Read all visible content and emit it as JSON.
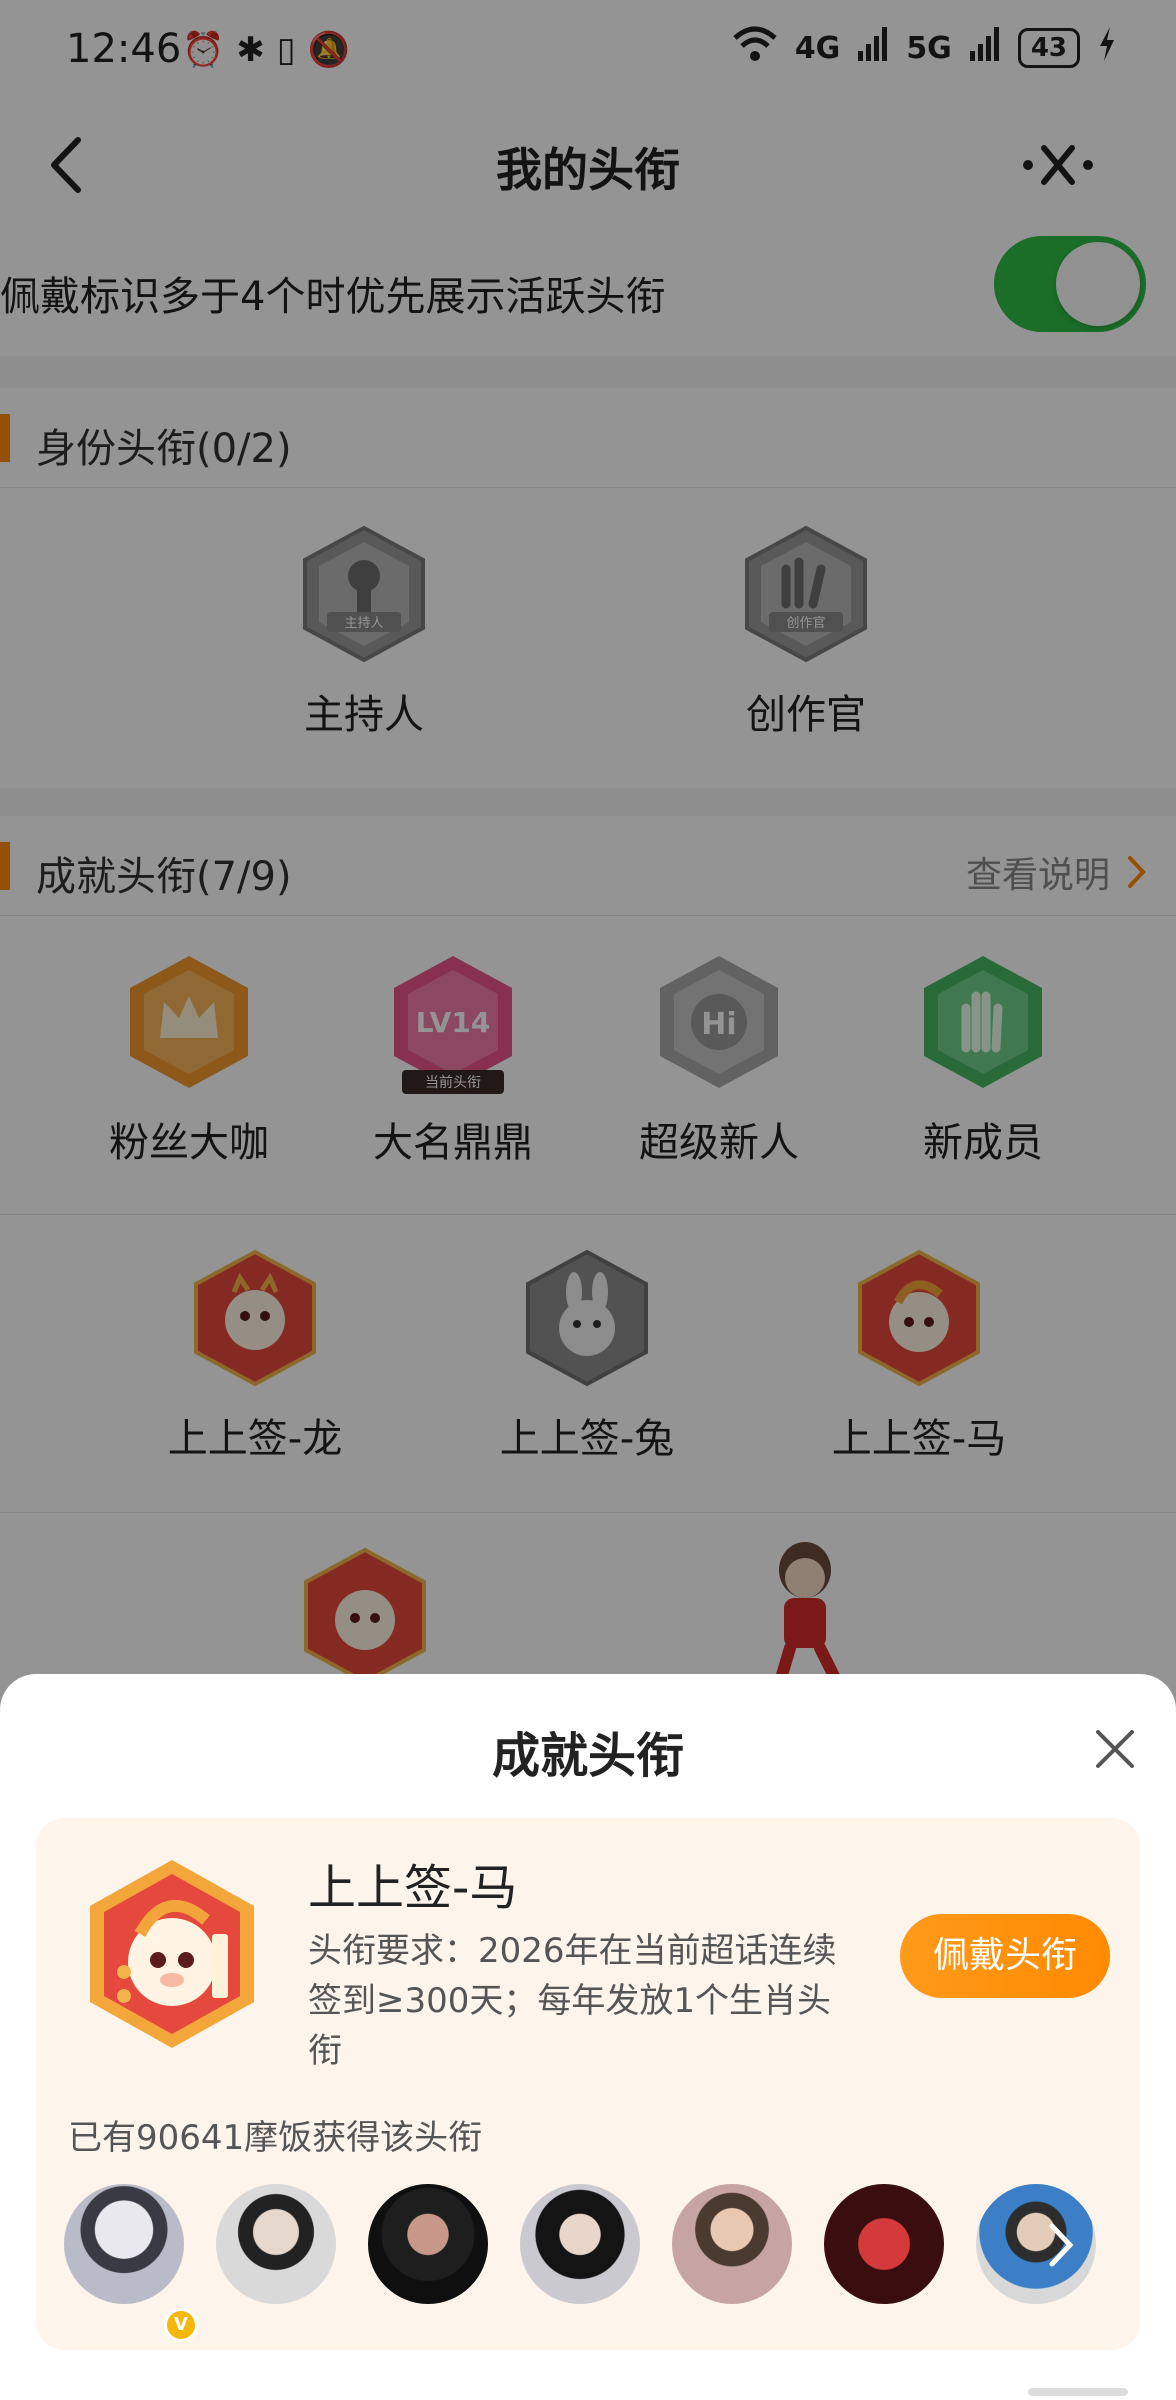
{
  "status_bar": {
    "time": "12:46",
    "network_a": "4G",
    "network_b": "5G",
    "battery": "43",
    "icons": [
      "alarm-icon",
      "bluetooth-icon",
      "vibrate-icon",
      "mute-icon",
      "wifi-icon",
      "signal-icon",
      "charging-icon"
    ]
  },
  "nav": {
    "title": "我的头衔",
    "back_icon": "back-chevron-icon",
    "more_icon": "more-close-icon"
  },
  "setting": {
    "label": "佩戴标识多于4个时优先展示活跃头衔",
    "enabled": true
  },
  "identity": {
    "title": "身份头衔(0/2)",
    "items": [
      {
        "label": "主持人",
        "badge_text": "主持人"
      },
      {
        "label": "创作官",
        "badge_text": "创作官"
      }
    ]
  },
  "achievement": {
    "title": "成就头衔(7/9)",
    "link": "查看说明",
    "row1": [
      {
        "label": "粉丝大咖",
        "color": "#f7a13a"
      },
      {
        "label": "大名鼎鼎",
        "color": "#ef5a8f",
        "badge_text": "LV14",
        "tag": "当前头衔"
      },
      {
        "label": "超级新人",
        "color": "#b5b5b5",
        "badge_text": "Hi"
      },
      {
        "label": "新成员",
        "color": "#4fc36b"
      }
    ],
    "row2": [
      {
        "label": "上上签-龙",
        "color": "#e5483d"
      },
      {
        "label": "上上签-兔",
        "color": "#9c9c9c"
      },
      {
        "label": "上上签-马",
        "color": "#e5483d"
      }
    ]
  },
  "sheet": {
    "title": "成就头衔",
    "name": "上上签-马",
    "requirement": "头衔要求：2026年在当前超话连续签到≥300天；每年发放1个生肖头衔",
    "button": "佩戴头衔",
    "owned_text": "已有90641摩饭获得该头衔",
    "accent": "#ff8a00"
  }
}
